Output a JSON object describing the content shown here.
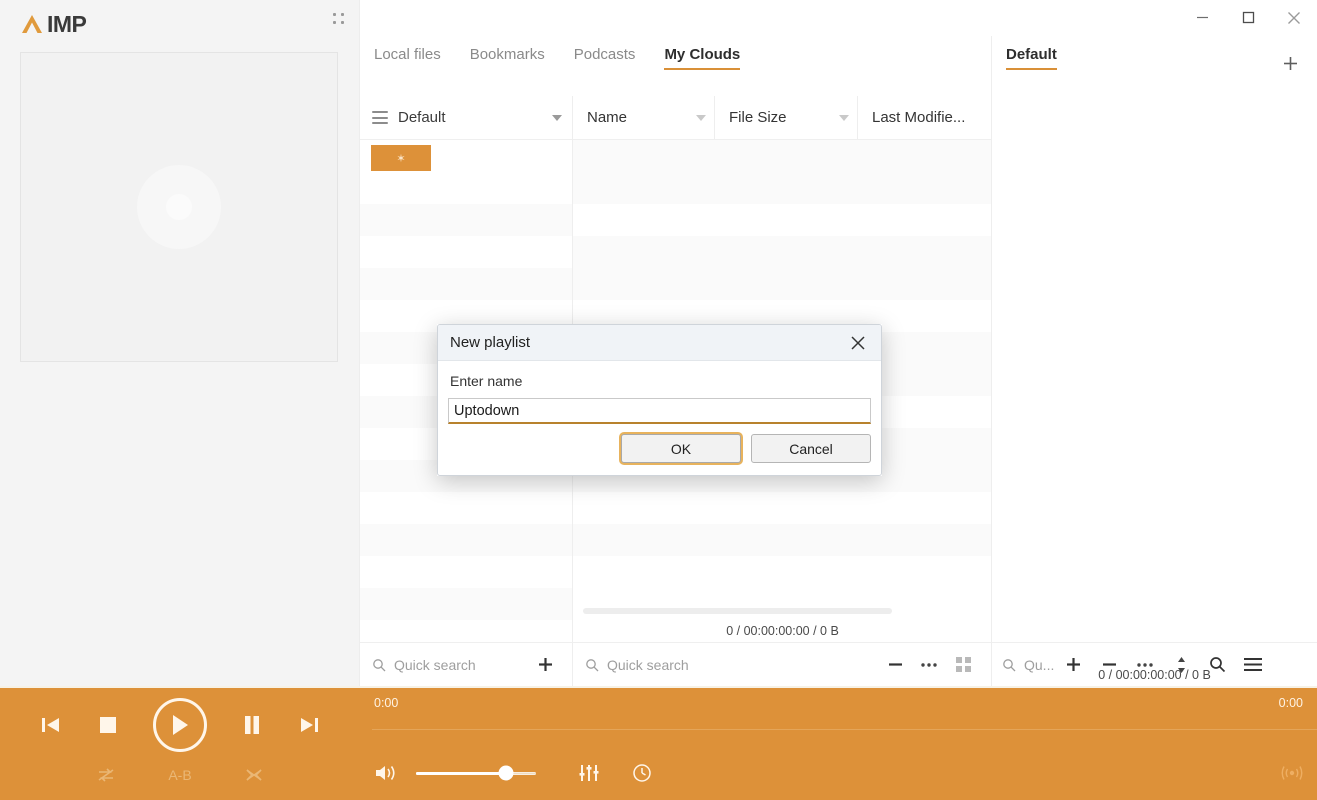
{
  "app": {
    "brand_name": "IMP",
    "logo_icon": "aimp-triangle-logo",
    "grip_icon": "drag-grip-icon"
  },
  "window": {
    "minimize_label": "–",
    "maximize_label": "□",
    "close_label": "×",
    "minimize_icon": "minimize-icon",
    "maximize_icon": "maximize-icon",
    "close_icon": "close-icon"
  },
  "albumart": {
    "placeholder_icon": "disc-placeholder-icon"
  },
  "tabs": [
    {
      "label": "Local files",
      "active": false
    },
    {
      "label": "Bookmarks",
      "active": false
    },
    {
      "label": "Podcasts",
      "active": false
    },
    {
      "label": "My Clouds",
      "active": true
    }
  ],
  "browser_panel": {
    "playlist_selector": {
      "label": "Default",
      "menu_icon": "hamburger-icon",
      "caret_icon": "chevron-down-icon"
    },
    "highlight_item": {
      "label": "✶"
    },
    "columns": [
      {
        "label": "Name",
        "filter_icon": "filter-icon"
      },
      {
        "label": "File Size",
        "filter_icon": "filter-icon"
      },
      {
        "label": "Last Modifie...",
        "filter_icon": ""
      }
    ],
    "status": "0 / 00:00:00:00 / 0 B",
    "search_placeholder": "Quick search",
    "left_search_placeholder": "Quick search",
    "add_label": "+",
    "remove_label": "–",
    "more_label": "•••",
    "view_label": "grid",
    "search_icon": "search-icon",
    "add_icon": "plus-icon",
    "remove_icon": "minus-icon",
    "more_icon": "ellipsis-icon",
    "grid_icon": "grid-view-icon"
  },
  "playlist_panel": {
    "tabs": [
      {
        "label": "Default",
        "active": true
      }
    ],
    "add_tab_label": "+",
    "add_tab_icon": "plus-icon",
    "status": "0 / 00:00:00:00 / 0 B",
    "search_placeholder": "Qu...",
    "toolbar_icons": [
      "search-icon",
      "plus-icon",
      "minus-icon",
      "ellipsis-icon",
      "sort-updown-icon",
      "magnifier-icon",
      "menu-icon"
    ]
  },
  "dialog": {
    "title": "New playlist",
    "close_icon": "close-icon",
    "field_label": "Enter name",
    "field_value": "Uptodown",
    "ok_label": "OK",
    "cancel_label": "Cancel"
  },
  "player": {
    "time_elapsed": "0:00",
    "time_total": "0:00",
    "prev_icon": "previous-track-icon",
    "stop_icon": "stop-icon",
    "play_icon": "play-icon",
    "pause_icon": "pause-icon",
    "next_icon": "next-track-icon",
    "repeat_icon": "repeat-icon",
    "ab_label": "A-B",
    "shuffle_icon": "shuffle-icon",
    "volume_icon": "volume-icon",
    "volume_percent": 75,
    "equalizer_icon": "equalizer-icon",
    "sleep_timer_icon": "clock-icon",
    "cast_icon": "broadcast-icon"
  },
  "colors": {
    "accent": "#dd9139",
    "accent_underline": "#d99038",
    "panel_bg": "#f4f4f4",
    "dialog_titlebar": "#f0f3f7",
    "input_underline": "#b8822d",
    "focus_ring": "#e8b35d"
  }
}
